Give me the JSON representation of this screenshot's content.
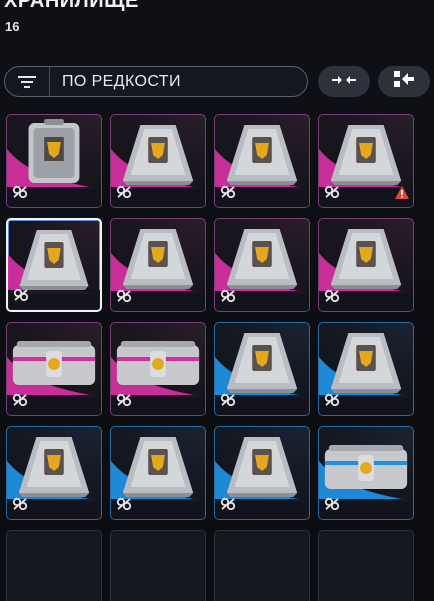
{
  "header": {
    "title": "ХРАНИЛИЩЕ",
    "count": "16"
  },
  "sort": {
    "label": "ПО РЕДКОСТИ",
    "icon": "sort-lines-icon"
  },
  "actions": [
    {
      "icon": "collapse-arrows-icon"
    },
    {
      "icon": "transfer-in-icon"
    }
  ],
  "colors": {
    "pink": "#d22f9f",
    "blue": "#1f8fe0",
    "warning": "#e0473a"
  },
  "grid": [
    {
      "rarity": "pink",
      "item": "box",
      "warning": false,
      "selected": false
    },
    {
      "rarity": "pink",
      "item": "pyramid",
      "warning": false,
      "selected": false
    },
    {
      "rarity": "pink",
      "item": "pyramid",
      "warning": false,
      "selected": false
    },
    {
      "rarity": "pink",
      "item": "pyramid",
      "warning": true,
      "selected": false
    },
    {
      "rarity": "pink",
      "item": "pyramid",
      "warning": false,
      "selected": true
    },
    {
      "rarity": "pink",
      "item": "pyramid",
      "warning": false,
      "selected": false
    },
    {
      "rarity": "pink",
      "item": "pyramid",
      "warning": false,
      "selected": false
    },
    {
      "rarity": "pink",
      "item": "pyramid",
      "warning": false,
      "selected": false
    },
    {
      "rarity": "pink",
      "item": "crate",
      "warning": false,
      "selected": false
    },
    {
      "rarity": "pink",
      "item": "crate",
      "warning": false,
      "selected": false
    },
    {
      "rarity": "blue",
      "item": "pyramid",
      "warning": false,
      "selected": false
    },
    {
      "rarity": "blue",
      "item": "pyramid",
      "warning": false,
      "selected": false
    },
    {
      "rarity": "blue",
      "item": "pyramid",
      "warning": false,
      "selected": false
    },
    {
      "rarity": "blue",
      "item": "pyramid",
      "warning": false,
      "selected": false
    },
    {
      "rarity": "blue",
      "item": "pyramid",
      "warning": false,
      "selected": false
    },
    {
      "rarity": "blue",
      "item": "crate",
      "warning": false,
      "selected": false
    },
    {
      "rarity": "empty",
      "item": "none",
      "warning": false,
      "selected": false
    },
    {
      "rarity": "empty",
      "item": "none",
      "warning": false,
      "selected": false
    },
    {
      "rarity": "empty",
      "item": "none",
      "warning": false,
      "selected": false
    },
    {
      "rarity": "empty",
      "item": "none",
      "warning": false,
      "selected": false
    }
  ]
}
